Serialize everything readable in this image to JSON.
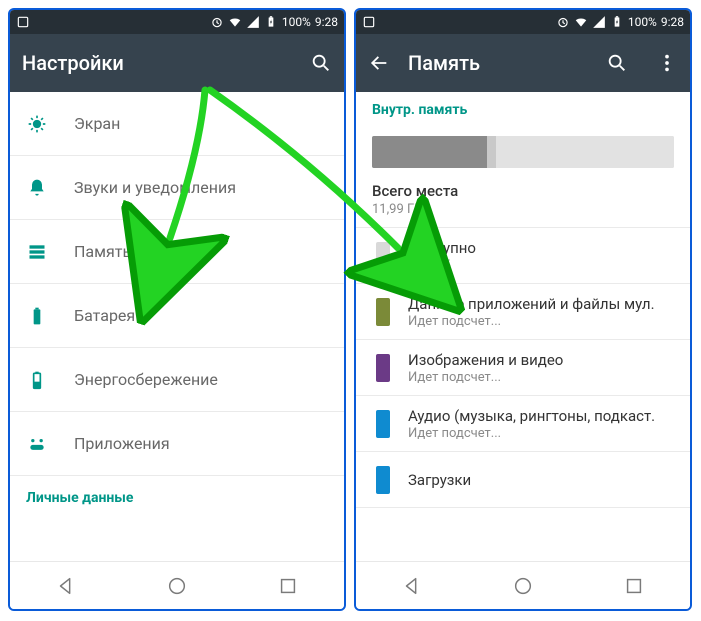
{
  "status": {
    "battery_pct": "100%",
    "time": "9:28"
  },
  "left": {
    "appbar_title": "Настройки",
    "items": [
      {
        "key": "display",
        "label": "Экран"
      },
      {
        "key": "sound",
        "label": "Звуки и уведомления"
      },
      {
        "key": "storage",
        "label": "Память"
      },
      {
        "key": "battery",
        "label": "Батарея"
      },
      {
        "key": "power",
        "label": "Энергосбережение"
      },
      {
        "key": "apps",
        "label": "Приложения"
      }
    ],
    "personal_header": "Личные данные"
  },
  "right": {
    "appbar_title": "Память",
    "internal_header": "Внутр. память",
    "bar_segments": [
      {
        "color": "#8a8a8a",
        "pct": 38
      },
      {
        "color": "#c9c9c9",
        "pct": 3
      },
      {
        "color": "#e2e2e2",
        "pct": 59
      }
    ],
    "total_label": "Всего места",
    "total_value": "11,99 ГБ",
    "items": [
      {
        "color": "#d9d9d9",
        "title": "Доступно",
        "sub": "6,63 ГБ"
      },
      {
        "color": "#7b8a38",
        "title": "Данные приложений и файлы мул.",
        "sub": "Идет подсчет..."
      },
      {
        "color": "#6b3a86",
        "title": "Изображения и видео",
        "sub": "Идет подсчет..."
      },
      {
        "color": "#0f8bd0",
        "title": "Аудио (музыка, рингтоны, подкаст.",
        "sub": "Идет подсчет..."
      },
      {
        "color": "#0f8bd0",
        "title": "Загрузки",
        "sub": ""
      }
    ]
  }
}
